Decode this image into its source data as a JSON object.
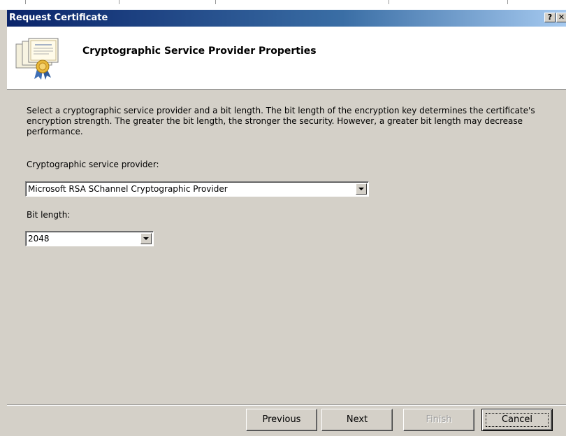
{
  "window": {
    "title": "Request Certificate",
    "help_button": "?",
    "close_button": "✕"
  },
  "header": {
    "title": "Cryptographic Service Provider Properties",
    "icon": "certificate-icon"
  },
  "body": {
    "description": "Select a cryptographic service provider and a bit length. The bit length of the encryption key determines the certificate's encryption strength. The greater the bit length, the stronger the security. However, a greater bit length may decrease performance.",
    "provider_label": "Cryptographic service provider:",
    "provider_value": "Microsoft RSA SChannel Cryptographic Provider",
    "bit_length_label": "Bit length:",
    "bit_length_value": "2048"
  },
  "footer": {
    "previous_label": "Previous",
    "next_label": "Next",
    "finish_label": "Finish",
    "cancel_label": "Cancel"
  },
  "colors": {
    "title_bar_start": "#0a246a",
    "title_bar_end": "#a6caf0",
    "dialog_background": "#d4d0c8",
    "disabled_text": "#a0a0a0"
  }
}
